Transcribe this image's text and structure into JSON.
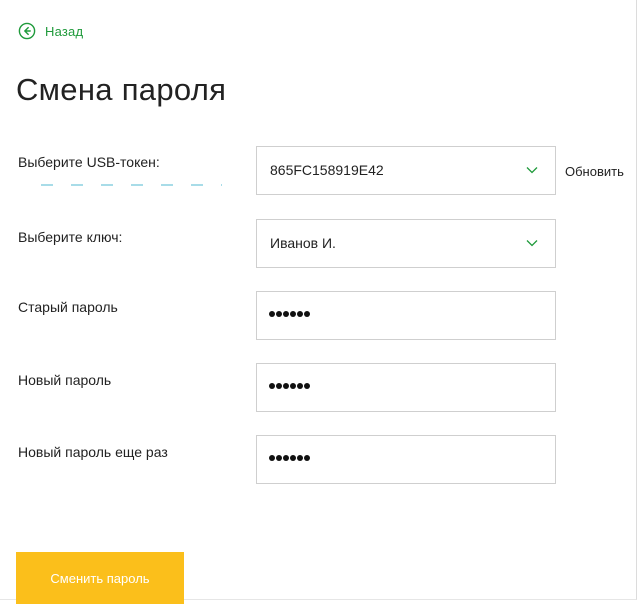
{
  "nav": {
    "back_label": "Назад"
  },
  "page": {
    "title": "Смена пароля"
  },
  "form": {
    "token": {
      "label": "Выберите USB-токен:",
      "value": "865FC158919E42",
      "refresh_label": "Обновить"
    },
    "key": {
      "label": "Выберите ключ:",
      "value": "Иванов И."
    },
    "old_password": {
      "label": "Старый пароль",
      "masked_length": 6
    },
    "new_password": {
      "label": "Новый пароль",
      "masked_length": 6
    },
    "new_password_repeat": {
      "label": "Новый пароль еще раз",
      "masked_length": 6
    },
    "submit_label": "Сменить пароль"
  },
  "colors": {
    "accent_green": "#1f9a3b",
    "button_yellow": "#fbbf1b"
  },
  "icons": {
    "back": "arrow-left-circle-icon",
    "dropdown": "chevron-down-icon"
  }
}
